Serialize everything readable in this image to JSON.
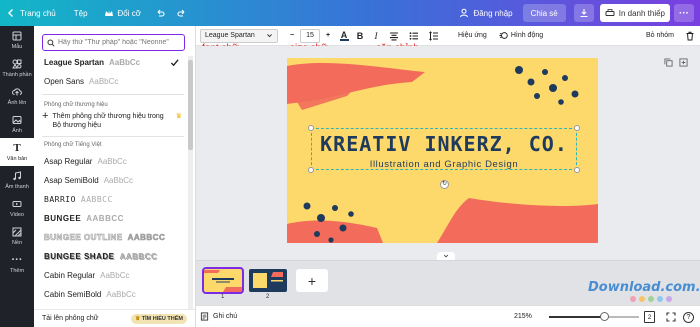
{
  "colors": {
    "accent": "#7d2ae8",
    "design_bg": "#fdd96b",
    "design_navy": "#1e3a5c",
    "design_coral": "#f26b5b",
    "annotation": "#e02020"
  },
  "topbar": {
    "home": "Trang chủ",
    "file": "Tệp",
    "resize": "Đổi cỡ",
    "login": "Đăng nhập",
    "share": "Chia sẻ",
    "print": "In danh thiếp"
  },
  "sidebar": {
    "items": [
      {
        "label": "Mẫu",
        "icon": "template-icon"
      },
      {
        "label": "Thành phần",
        "icon": "shapes-icon"
      },
      {
        "label": "Ảnh lên",
        "icon": "upload-icon"
      },
      {
        "label": "Ảnh",
        "icon": "photo-icon"
      },
      {
        "label": "Văn bản",
        "icon": "text-icon"
      },
      {
        "label": "Âm thanh",
        "icon": "music-icon"
      },
      {
        "label": "Video",
        "icon": "video-icon"
      },
      {
        "label": "Nền",
        "icon": "background-icon"
      },
      {
        "label": "Thêm",
        "icon": "more-icon"
      }
    ]
  },
  "font_panel": {
    "search_placeholder": "Hãy thử \"Thư pháp\" hoặc \"Neonne\"",
    "current": {
      "name": "League Spartan",
      "preview": "AaBbCc"
    },
    "open_sans": {
      "name": "Open Sans",
      "preview": "AaBbCc"
    },
    "brand_heading": "Phông chữ thương hiệu",
    "brand_add": "Thêm phông chữ thương hiệu trong Bộ thương hiệu",
    "viet_heading": "Phông chữ Tiếng Việt",
    "fonts": [
      {
        "name": "Asap Regular",
        "preview": "AaBbCc"
      },
      {
        "name": "Asap SemiBold",
        "preview": "AaBbCc"
      },
      {
        "name": "BARRIO",
        "preview": "AABBCC"
      },
      {
        "name": "BUNGEE",
        "preview": "AABBCC"
      },
      {
        "name": "BUNGEE OUTLINE",
        "preview": "AABBCC"
      },
      {
        "name": "BUNGEE SHADE",
        "preview": "AABBCC"
      },
      {
        "name": "Cabin Regular",
        "preview": "AaBbCc"
      },
      {
        "name": "Cabin SemiBold",
        "preview": "AaBbCc"
      }
    ],
    "upload": "Tải lên phông chữ",
    "learn_more": "TÌM HIỂU THÊM"
  },
  "toolbar": {
    "font": "League Spartan",
    "size": "15",
    "effects": "Hiệu ứng",
    "animate": "Hình động",
    "ungroup": "Bỏ nhóm"
  },
  "annotations": {
    "font": "font chữ",
    "size": "size chữ",
    "align": "căn chỉnh"
  },
  "design": {
    "title": "KREATIV INKERZ, CO.",
    "subtitle": "Illustration and Graphic Design"
  },
  "pages": {
    "p1": "1",
    "p2": "2"
  },
  "bottom": {
    "notes": "Ghi chú",
    "zoom": "215%",
    "zoom_level": 0.62,
    "page_count": "2"
  },
  "watermark": "Download.com.vn"
}
